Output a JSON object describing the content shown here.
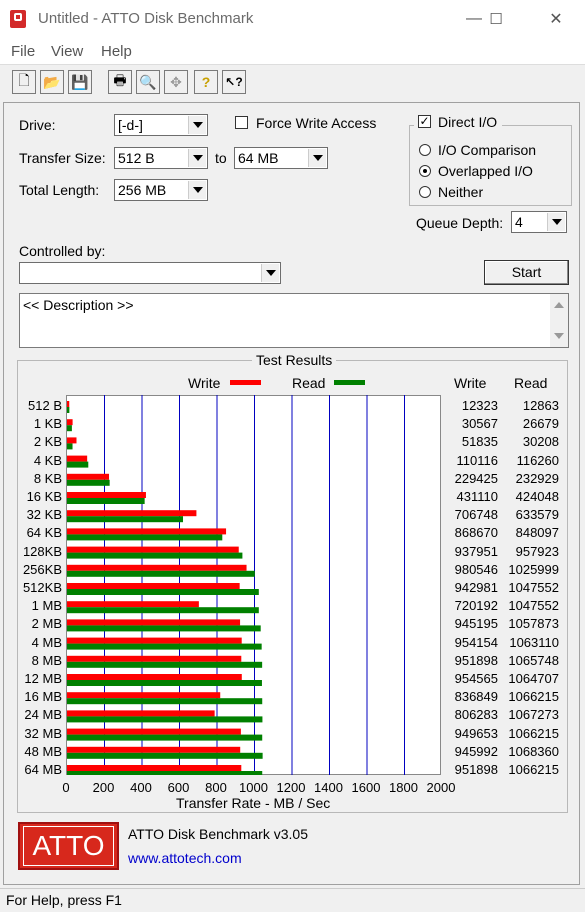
{
  "window": {
    "title": "Untitled - ATTO Disk Benchmark",
    "minimize": "—",
    "maximize": "☐",
    "close": "✕"
  },
  "menu": {
    "file": "File",
    "view": "View",
    "help": "Help"
  },
  "toolbar": {
    "new": "🗋",
    "open": "📂",
    "save": "💾",
    "print": "🖶",
    "preview": "🔍",
    "move": "✥",
    "help": "?",
    "context_help": "↖?"
  },
  "form": {
    "drive_label": "Drive:",
    "drive_value": "[-d-]",
    "force_write_label": "Force Write Access",
    "force_write_checked": "",
    "direct_io_label": "Direct I/O",
    "direct_io_checked": "✓",
    "io_comparison_label": "I/O Comparison",
    "overlapped_io_label": "Overlapped I/O",
    "neither_label": "Neither",
    "transfer_size_label": "Transfer Size:",
    "transfer_from": "512 B",
    "to_label": "to",
    "transfer_to": "64 MB",
    "total_length_label": "Total Length:",
    "total_length": "256 MB",
    "queue_depth_label": "Queue Depth:",
    "queue_depth": "4",
    "controlled_by_label": "Controlled by:",
    "controlled_by_value": "",
    "start_button": "Start",
    "description": "<< Description >>"
  },
  "results": {
    "group_title": "Test Results",
    "legend_write": "Write",
    "legend_read": "Read",
    "col_write": "Write",
    "col_read": "Read",
    "write_color": "#ff0000",
    "read_color": "#008000"
  },
  "chart_data": {
    "type": "bar",
    "orientation": "horizontal",
    "categories": [
      "512 B",
      "1 KB",
      "2 KB",
      "4 KB",
      "8 KB",
      "16 KB",
      "32 KB",
      "64 KB",
      "128KB",
      "256KB",
      "512KB",
      "1 MB",
      "2 MB",
      "4 MB",
      "8 MB",
      "12 MB",
      "16 MB",
      "24 MB",
      "32 MB",
      "48 MB",
      "64 MB"
    ],
    "series": [
      {
        "name": "Write",
        "values": [
          12323,
          30567,
          51835,
          110116,
          229425,
          431110,
          706748,
          868670,
          937951,
          980546,
          942981,
          720192,
          945195,
          954154,
          951898,
          954565,
          836849,
          806283,
          949653,
          945992,
          951898
        ]
      },
      {
        "name": "Read",
        "values": [
          12863,
          26679,
          30208,
          116260,
          232929,
          424048,
          633579,
          848097,
          957923,
          1025999,
          1047552,
          1047552,
          1057873,
          1063110,
          1065748,
          1064707,
          1066215,
          1067273,
          1066215,
          1068360,
          1066215
        ]
      }
    ],
    "write_text": [
      "12323",
      "30567",
      "51835",
      "110116",
      "229425",
      "431110",
      "706748",
      "868670",
      "937951",
      "980546",
      "942981",
      "720192",
      "945195",
      "954154",
      "951898",
      "954565",
      "836849",
      "806283",
      "949653",
      "945992",
      "951898"
    ],
    "read_text": [
      "12863",
      "26679",
      "30208",
      "116260",
      "232929",
      "424048",
      "633579",
      "848097",
      "957923",
      "1025999",
      "1047552",
      "1047552",
      "1057873",
      "1063110",
      "1065748",
      "1064707",
      "1066215",
      "1067273",
      "1066215",
      "1068360",
      "1066215"
    ],
    "x_ticks": [
      "0",
      "200",
      "400",
      "600",
      "800",
      "1000",
      "1200",
      "1400",
      "1600",
      "1800",
      "2000"
    ],
    "xlim": [
      0,
      2000
    ],
    "xlabel": "Transfer Rate - MB / Sec",
    "grid": true
  },
  "footer": {
    "logo": "ATTO",
    "product": "ATTO Disk Benchmark v3.05",
    "url": "www.attotech.com"
  },
  "status": {
    "text": "For Help, press F1"
  }
}
